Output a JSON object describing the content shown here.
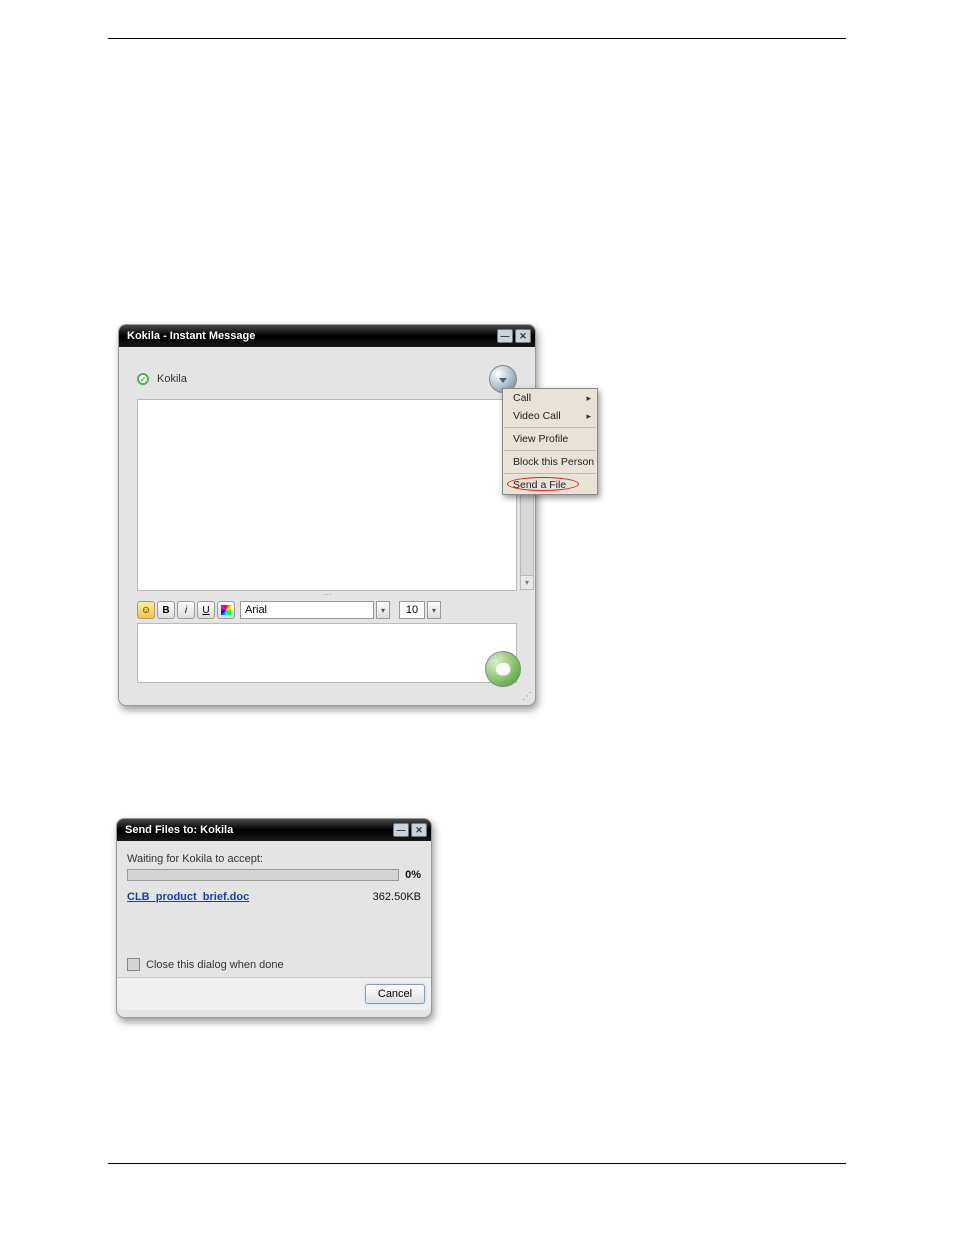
{
  "chat": {
    "title": "Kokila - Instant Message",
    "contact_name": "Kokila",
    "font": {
      "family": "Arial",
      "size": "10"
    },
    "format_labels": {
      "bold": "B",
      "italic": "i",
      "underline": "U"
    }
  },
  "menu": {
    "items": [
      {
        "label": "Call",
        "submenu": true
      },
      {
        "label": "Video Call",
        "submenu": true
      },
      {
        "label": "View Profile",
        "submenu": false
      },
      {
        "label": "Block this Person",
        "submenu": false
      },
      {
        "label": "Send a File",
        "submenu": false,
        "highlighted": true
      }
    ]
  },
  "send": {
    "title": "Send Files to: Kokila",
    "waiting": "Waiting for Kokila to accept:",
    "progress": "0%",
    "file_name": "CLB_product_brief.doc",
    "file_size": "362.50KB",
    "close_checkbox": "Close this dialog when done",
    "cancel": "Cancel"
  }
}
